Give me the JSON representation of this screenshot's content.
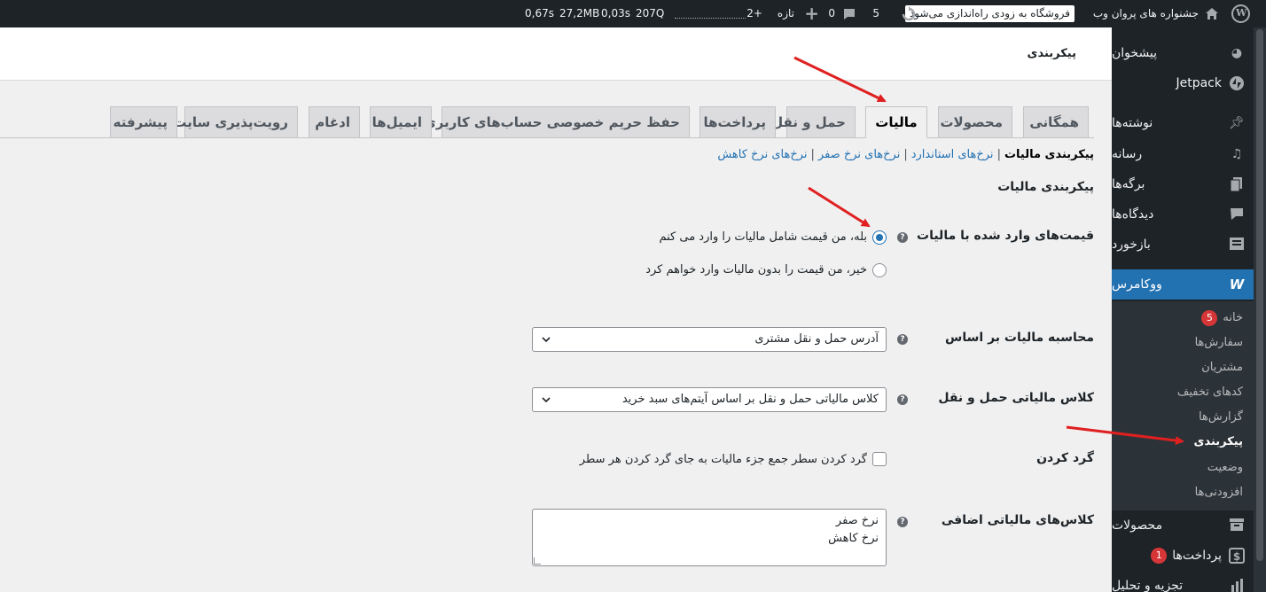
{
  "adminbar": {
    "site_name": "جشنواره های پروان وب",
    "store_notice": "فروشگاه به زودی راه‌اندازی می‌شود",
    "updates_count": "5",
    "comments_count": "0",
    "new_label": "تازه",
    "plus_count": "2+",
    "perf_q": "207Q",
    "perf_t1": "0,03s",
    "perf_mem": "27,2MB",
    "perf_t2": "0,67s"
  },
  "sidebar": {
    "dashboard": "پیشخوان",
    "jetpack": "Jetpack",
    "posts": "نوشته‌ها",
    "media": "رسانه",
    "pages": "برگه‌ها",
    "comments": "دیدگاه‌ها",
    "feedback": "بازخورد",
    "woocommerce": "ووکامرس",
    "submenu": {
      "home": "خانه",
      "home_badge": "5",
      "orders": "سفارش‌ها",
      "customers": "مشتریان",
      "coupons": "کدهای تخفیف",
      "reports": "گزارش‌ها",
      "settings": "پیکربندی",
      "status": "وضعیت",
      "extensions": "افزودنی‌ها"
    },
    "products": "محصولات",
    "payments": "پرداخت‌ها",
    "payments_badge": "1",
    "analytics": "تجزیه و تحلیل"
  },
  "header": {
    "title": "پیکربندی"
  },
  "tabs": {
    "general": "همگانی",
    "products": "محصولات",
    "tax": "مالیات",
    "shipping": "حمل و نقل",
    "payments": "پرداخت‌ها",
    "privacy": "حفظ حریم خصوصی حساب‌های کاربری",
    "emails": "ایمیل‌ها",
    "integration": "ادغام",
    "site_visibility": "رویت‌پذیری سایت",
    "advanced": "پیشرفته"
  },
  "subsub": {
    "tax_options": "پیکربندی مالیات",
    "standard_rates": "نرخ‌های استاندارد",
    "zero_rates": "نرخ‌های نرخ صفر",
    "reduced_rates": "نرخ‌های نرخ کاهش"
  },
  "section_title": "پیکربندی مالیات",
  "fields": {
    "prices_entered": {
      "label": "قیمت‌های وارد شده با مالیات",
      "yes": "بله، من قیمت شامل مالیات را وارد می کنم",
      "no": "خیر، من قیمت را بدون مالیات وارد خواهم کرد",
      "selected": "yes"
    },
    "calc_based_on": {
      "label": "محاسبه مالیات بر اساس",
      "value": "آدرس حمل و نقل مشتری"
    },
    "shipping_tax_class": {
      "label": "کلاس مالیاتی حمل و نقل",
      "value": "کلاس مالیاتی حمل و نقل بر اساس آیتم‌های سبد خرید"
    },
    "rounding": {
      "label": "گرد کردن",
      "checkbox_label": "گرد کردن سطر جمع جزء مالیات به جای گرد کردن هر سطر",
      "checked": false
    },
    "additional_classes": {
      "label": "کلاس‌های مالیاتی اضافی",
      "line1": "نرخ صفر",
      "line2": "نرخ کاهش"
    }
  },
  "colors": {
    "admin_dark": "#1d2327",
    "accent": "#2271b1",
    "annotation_arrow": "#e02020",
    "badge": "#d63638"
  }
}
